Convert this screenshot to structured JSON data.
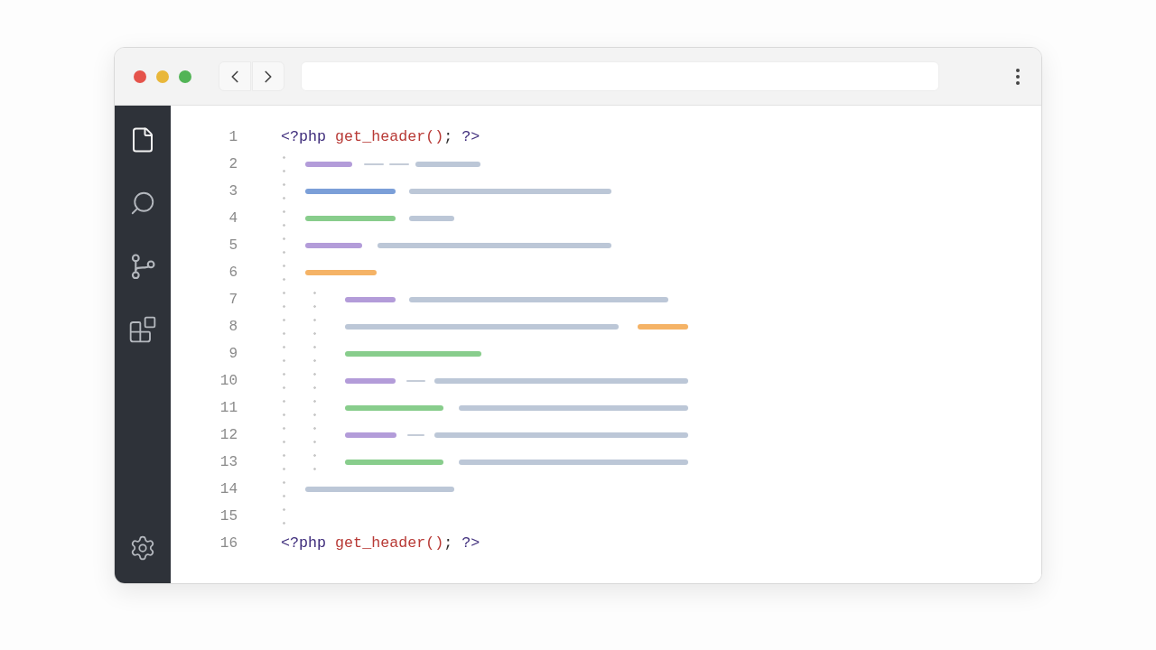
{
  "activity_bar": {
    "items": [
      {
        "kind": "files",
        "selected": true
      },
      {
        "kind": "search",
        "selected": false
      },
      {
        "kind": "source_control",
        "selected": false
      },
      {
        "kind": "extensions",
        "selected": false
      },
      {
        "kind": "settings",
        "selected": false
      }
    ]
  },
  "editor": {
    "lines": [
      {
        "number": "1",
        "tokens": [
          {
            "text": "<?php",
            "space_before": false,
            "color": "#3f2d7c"
          },
          {
            "text": "get_header()",
            "space_before": true,
            "color": "#b83a36"
          },
          {
            "text": ";",
            "space_before": false,
            "color": "#2f2f2f"
          },
          {
            "text": "?>",
            "space_before": true,
            "color": "#3f2d7c"
          }
        ],
        "children": [
          {
            "number": "2",
            "segments": [
              {
                "kind": "bar",
                "color": "#b39cd9"
              },
              {
                "kind": "dash",
                "color": "#c5ccd8"
              },
              {
                "kind": "dash",
                "color": "#c5ccd8"
              },
              {
                "kind": "bar",
                "color": "#bcc7d7"
              }
            ]
          },
          {
            "number": "3",
            "segments": [
              {
                "kind": "bar",
                "color": "#7b9fd8"
              },
              {
                "kind": "bar",
                "color": "#bcc7d7"
              }
            ]
          },
          {
            "number": "4",
            "segments": [
              {
                "kind": "bar",
                "color": "#88cd8c"
              },
              {
                "kind": "bar",
                "color": "#bcc7d7"
              }
            ]
          },
          {
            "number": "5",
            "segments": [
              {
                "kind": "bar",
                "color": "#b39cd9"
              },
              {
                "kind": "bar",
                "color": "#bcc7d7"
              }
            ]
          },
          {
            "number": "6",
            "segments": [
              {
                "kind": "bar",
                "color": "#f5b366"
              }
            ],
            "children": [
              {
                "number": "7",
                "segments": [
                  {
                    "kind": "bar",
                    "color": "#b39cd9"
                  },
                  {
                    "kind": "bar",
                    "color": "#bcc7d7"
                  }
                ]
              },
              {
                "number": "8",
                "segments": [
                  {
                    "kind": "bar",
                    "color": "#bcc7d7"
                  },
                  {
                    "kind": "bar",
                    "color": "#f5b366"
                  }
                ]
              },
              {
                "number": "9",
                "segments": [
                  {
                    "kind": "bar",
                    "color": "#88cd8c"
                  }
                ]
              },
              {
                "number": "10",
                "segments": [
                  {
                    "kind": "bar",
                    "color": "#b39cd9"
                  },
                  {
                    "kind": "dash",
                    "color": "#c5ccd8"
                  },
                  {
                    "kind": "bar",
                    "color": "#bcc7d7"
                  }
                ]
              },
              {
                "number": "11",
                "segments": [
                  {
                    "kind": "bar",
                    "color": "#88cd8c"
                  },
                  {
                    "kind": "bar",
                    "color": "#bcc7d7"
                  }
                ]
              },
              {
                "number": "12",
                "segments": [
                  {
                    "kind": "bar",
                    "color": "#b39cd9"
                  },
                  {
                    "kind": "dash",
                    "color": "#c5ccd8"
                  },
                  {
                    "kind": "bar",
                    "color": "#bcc7d7"
                  }
                ]
              },
              {
                "number": "13",
                "segments": [
                  {
                    "kind": "bar",
                    "color": "#88cd8c"
                  },
                  {
                    "kind": "bar",
                    "color": "#bcc7d7"
                  }
                ]
              }
            ]
          },
          {
            "number": "14",
            "segments": [
              {
                "kind": "bar",
                "color": "#bcc7d7"
              }
            ]
          },
          {
            "number": "15"
          }
        ]
      },
      {
        "number": "16",
        "tokens": [
          {
            "text": "<?php",
            "space_before": false,
            "color": "#3f2d7c"
          },
          {
            "text": "get_header()",
            "space_before": true,
            "color": "#b83a36"
          },
          {
            "text": ";",
            "space_before": false,
            "color": "#2f2f2f"
          },
          {
            "text": "?>",
            "space_before": true,
            "color": "#3f2d7c"
          }
        ]
      }
    ]
  }
}
